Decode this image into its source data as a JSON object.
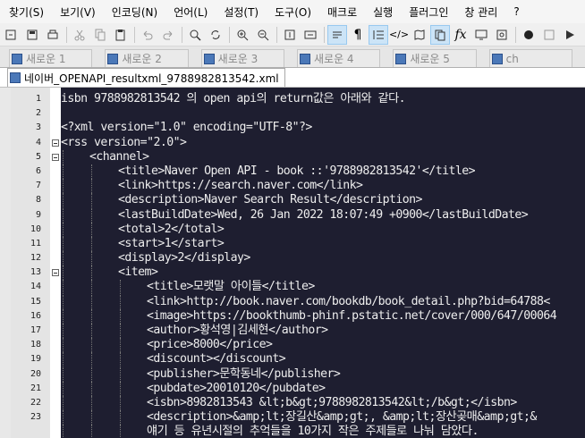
{
  "menu": [
    "찾기(S)",
    "보기(V)",
    "인코딩(N)",
    "언어(L)",
    "설정(T)",
    "도구(O)",
    "매크로",
    "실행",
    "플러그인",
    "창 관리",
    "?"
  ],
  "toolbar_icons": [
    "new-file-icon",
    "open-icon",
    "save-icon",
    "print-icon",
    "cut-icon",
    "copy-icon",
    "paste-icon",
    "undo-icon",
    "redo-icon",
    "find-icon",
    "replace-icon",
    "zoom-in-icon",
    "zoom-out-icon",
    "sync-v-icon",
    "sync-h-icon",
    "word-wrap-icon",
    "show-all-chars-icon",
    "indent-guide-icon",
    "xml-icon",
    "doc-map-icon",
    "function-list-icon",
    "fx-icon",
    "monitor-icon",
    "folder-view-icon",
    "record-macro-icon",
    "stop-macro-icon"
  ],
  "tabs": [
    {
      "label": "새로운 1"
    },
    {
      "label": "새로운 2"
    },
    {
      "label": "새로운 3"
    },
    {
      "label": "새로운 4"
    },
    {
      "label": "새로운 5"
    },
    {
      "label": "ch"
    }
  ],
  "file": {
    "name": "네이버_OPENAPI_resultxml_9788982813542.xml"
  },
  "lines": [
    {
      "n": "1",
      "indent": 0,
      "fold": false,
      "text": "isbn 9788982813542 의 open api의 return값은 아래와 같다."
    },
    {
      "n": "2",
      "indent": 0,
      "fold": false,
      "text": ""
    },
    {
      "n": "3",
      "indent": 0,
      "fold": false,
      "text": "<?xml version=\"1.0\" encoding=\"UTF-8\"?>"
    },
    {
      "n": "4",
      "indent": 0,
      "fold": true,
      "text": "<rss version=\"2.0\">"
    },
    {
      "n": "5",
      "indent": 1,
      "fold": true,
      "text": "<channel>"
    },
    {
      "n": "6",
      "indent": 2,
      "fold": false,
      "text": "<title>Naver Open API - book ::'9788982813542'</title>"
    },
    {
      "n": "7",
      "indent": 2,
      "fold": false,
      "text": "<link>https://search.naver.com</link>"
    },
    {
      "n": "8",
      "indent": 2,
      "fold": false,
      "text": "<description>Naver Search Result</description>"
    },
    {
      "n": "9",
      "indent": 2,
      "fold": false,
      "text": "<lastBuildDate>Wed, 26 Jan 2022 18:07:49 +0900</lastBuildDate>"
    },
    {
      "n": "10",
      "indent": 2,
      "fold": false,
      "text": "<total>2</total>"
    },
    {
      "n": "11",
      "indent": 2,
      "fold": false,
      "text": "<start>1</start>"
    },
    {
      "n": "12",
      "indent": 2,
      "fold": false,
      "text": "<display>2</display>"
    },
    {
      "n": "13",
      "indent": 2,
      "fold": true,
      "text": "<item>"
    },
    {
      "n": "14",
      "indent": 3,
      "fold": false,
      "text": "<title>모랫말 아이들</title>"
    },
    {
      "n": "15",
      "indent": 3,
      "fold": false,
      "text": "<link>http://book.naver.com/bookdb/book_detail.php?bid=64788<"
    },
    {
      "n": "16",
      "indent": 3,
      "fold": false,
      "text": "<image>https://bookthumb-phinf.pstatic.net/cover/000/647/00064"
    },
    {
      "n": "17",
      "indent": 3,
      "fold": false,
      "text": "<author>황석영|김세현</author>"
    },
    {
      "n": "18",
      "indent": 3,
      "fold": false,
      "text": "<price>8000</price>"
    },
    {
      "n": "19",
      "indent": 3,
      "fold": false,
      "text": "<discount></discount>"
    },
    {
      "n": "20",
      "indent": 3,
      "fold": false,
      "text": "<publisher>문학동네</publisher>"
    },
    {
      "n": "21",
      "indent": 3,
      "fold": false,
      "text": "<pubdate>20010120</pubdate>"
    },
    {
      "n": "22",
      "indent": 3,
      "fold": false,
      "text": "<isbn>8982813543 &lt;b&gt;9788982813542&lt;/b&gt;</isbn>"
    },
    {
      "n": "23",
      "indent": 3,
      "fold": false,
      "text": "<description>&amp;lt;장길산&amp;gt;, &amp;lt;장산곶매&amp;gt;&"
    },
    {
      "n": "",
      "indent": 3,
      "fold": false,
      "text": "얘기 등 유년시절의 추억들을 10가지 작은 주제들로 나눠 담았다."
    },
    {
      "n": "",
      "indent": 2,
      "fold": false,
      "text": ""
    }
  ]
}
